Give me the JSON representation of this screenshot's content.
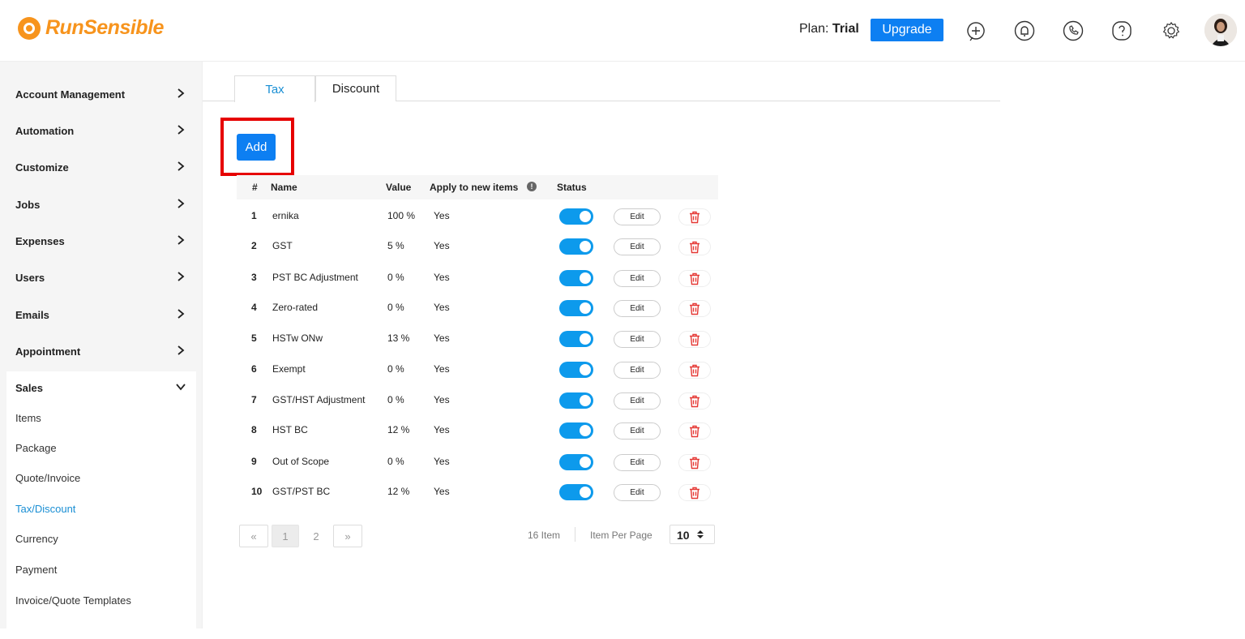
{
  "header": {
    "logo_text": "RunSensible",
    "plan_label": "Plan:",
    "plan_value": "Trial",
    "upgrade_label": "Upgrade",
    "icons": [
      "add-icon",
      "bell-icon",
      "phone-icon",
      "help-icon",
      "gear-icon"
    ]
  },
  "sidebar": {
    "items": [
      {
        "label": "Account Management",
        "expanded": false
      },
      {
        "label": "Automation",
        "expanded": false
      },
      {
        "label": "Customize",
        "expanded": false
      },
      {
        "label": "Jobs",
        "expanded": false
      },
      {
        "label": "Expenses",
        "expanded": false
      },
      {
        "label": "Users",
        "expanded": false
      },
      {
        "label": "Emails",
        "expanded": false
      },
      {
        "label": "Appointment",
        "expanded": false
      },
      {
        "label": "Sales",
        "expanded": true
      }
    ],
    "sales_sub": [
      {
        "label": "Items",
        "active": false
      },
      {
        "label": "Package",
        "active": false
      },
      {
        "label": "Quote/Invoice",
        "active": false
      },
      {
        "label": "Tax/Discount",
        "active": true
      },
      {
        "label": "Currency",
        "active": false
      },
      {
        "label": "Payment",
        "active": false
      },
      {
        "label": "Invoice/Quote Templates",
        "active": false
      }
    ]
  },
  "tabs": [
    {
      "label": "Tax",
      "active": true
    },
    {
      "label": "Discount",
      "active": false
    }
  ],
  "add_label": "Add",
  "table": {
    "headers": {
      "num": "#",
      "name": "Name",
      "value": "Value",
      "apply": "Apply to new items",
      "status": "Status"
    },
    "edit_label": "Edit",
    "rows": [
      {
        "num": "1",
        "name": "ernika",
        "value": "100 %",
        "apply": "Yes",
        "status": true
      },
      {
        "num": "2",
        "name": "GST",
        "value": "5 %",
        "apply": "Yes",
        "status": true
      },
      {
        "num": "3",
        "name": "PST BC Adjustment",
        "value": "0 %",
        "apply": "Yes",
        "status": true
      },
      {
        "num": "4",
        "name": "Zero-rated",
        "value": "0 %",
        "apply": "Yes",
        "status": true
      },
      {
        "num": "5",
        "name": "HSTw ONw",
        "value": "13 %",
        "apply": "Yes",
        "status": true
      },
      {
        "num": "6",
        "name": "Exempt",
        "value": "0 %",
        "apply": "Yes",
        "status": true
      },
      {
        "num": "7",
        "name": "GST/HST Adjustment",
        "value": "0 %",
        "apply": "Yes",
        "status": true
      },
      {
        "num": "8",
        "name": "HST BC",
        "value": "12 %",
        "apply": "Yes",
        "status": true
      },
      {
        "num": "9",
        "name": "Out of Scope",
        "value": "0 %",
        "apply": "Yes",
        "status": true
      },
      {
        "num": "10",
        "name": "GST/PST BC",
        "value": "12 %",
        "apply": "Yes",
        "status": true
      }
    ]
  },
  "pagination": {
    "prev": "«",
    "pages": [
      "1",
      "2"
    ],
    "current": "1",
    "next": "»",
    "total": "16 Item",
    "per_page_label": "Item Per Page",
    "per_page_value": "10"
  },
  "colors": {
    "accent": "#0d7ff2",
    "toggle": "#0d9aec",
    "brand": "#f7941d",
    "danger": "#e53935",
    "active_link": "#1a8fd4"
  }
}
